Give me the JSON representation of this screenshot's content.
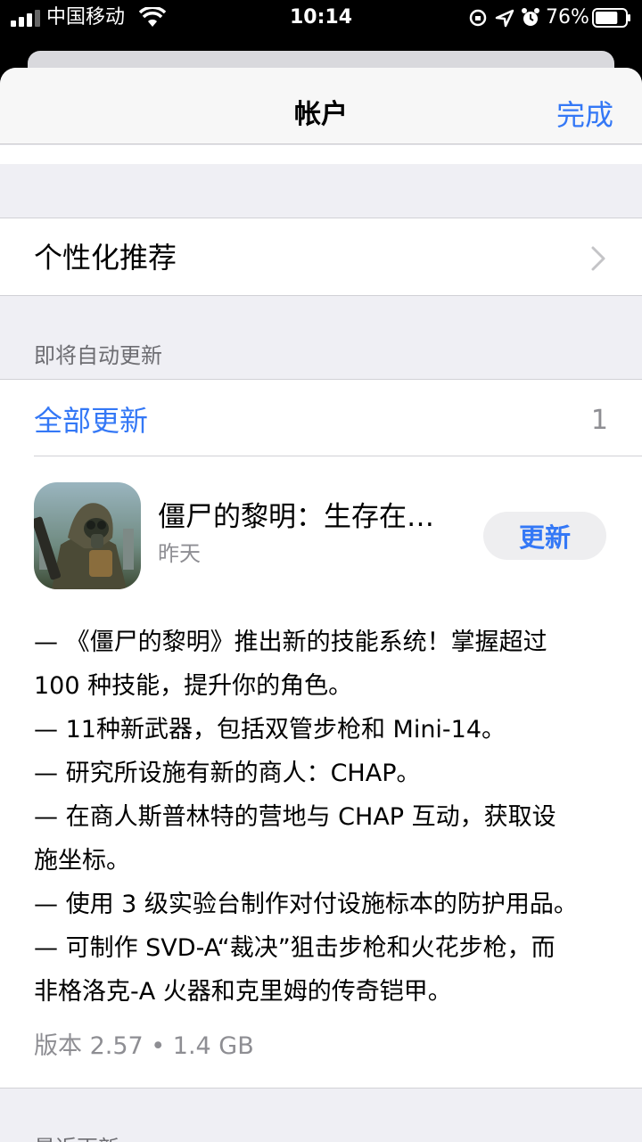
{
  "status_bar": {
    "carrier": "中国移动",
    "time": "10:14",
    "battery_percent": "76%",
    "battery_level": 0.76,
    "icons": [
      "signal-icon",
      "wifi-icon",
      "screen-lock-icon",
      "location-icon",
      "alarm-icon",
      "battery-icon"
    ]
  },
  "nav": {
    "title": "帐户",
    "done_label": "完成"
  },
  "personalized": {
    "label": "个性化推荐",
    "icon": "chevron-right-icon"
  },
  "auto_update_section": {
    "header": "即将自动更新",
    "update_all_label": "全部更新",
    "count": "1"
  },
  "app": {
    "name": "僵尸的黎明：生存在…",
    "date": "昨天",
    "update_label": "更新",
    "notes": [
      "— 《僵尸的黎明》推出新的技能系统！掌握超过",
      "100 种技能，提升你的角色。",
      "— 11种新武器，包括双管步枪和 Mini-14。",
      "— 研究所设施有新的商人：CHAP。",
      "— 在商人斯普林特的营地与 CHAP 互动，获取设",
      "施坐标。",
      "— 使用 3 级实验台制作对付设施标本的防护用品。",
      "— 可制作 SVD-A“裁决”狙击步枪和火花步枪，而",
      "非格洛克-A 火器和克里姆的传奇铠甲。"
    ],
    "version": "版本 2.57 • 1.4 GB"
  },
  "recent_section": {
    "header": "最近更新"
  },
  "colors": {
    "accent": "#3478f6",
    "background": "#efeff4",
    "secondary_text": "#8e8e93"
  }
}
